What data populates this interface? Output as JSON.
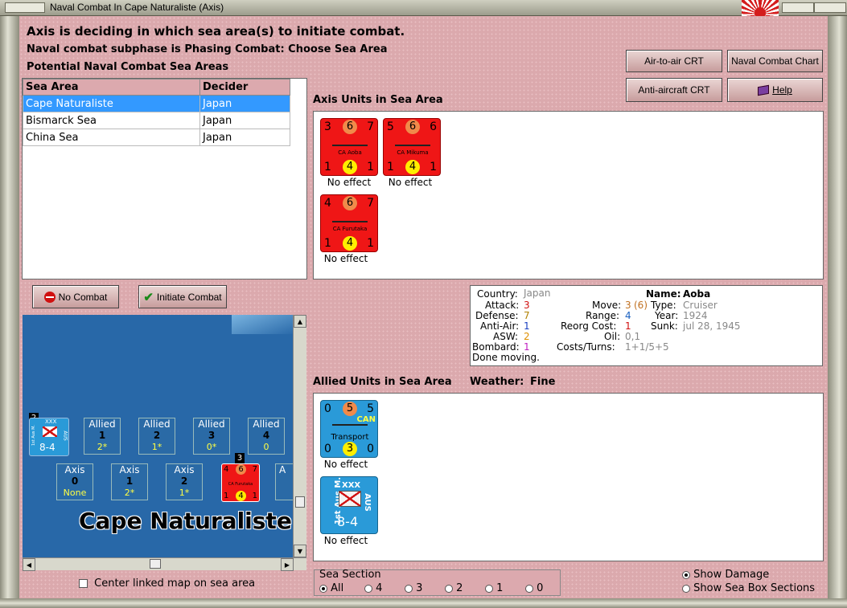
{
  "window": {
    "title": "Naval Combat In Cape Naturaliste (Axis)"
  },
  "header": {
    "line1": "Axis is deciding in which sea area(s) to initiate combat.",
    "line2": "Naval combat subphase is Phasing Combat: Choose Sea Area",
    "line3": "Potential Naval Combat Sea Areas"
  },
  "buttons": {
    "air_to_air": "Air-to-air CRT",
    "naval_chart": "Naval Combat Chart",
    "anti_aircraft": "Anti-aircraft CRT",
    "help": "Help",
    "no_combat": "No Combat",
    "initiate_combat": "Initiate Combat"
  },
  "sea_table": {
    "headers": [
      "Sea Area",
      "Decider"
    ],
    "rows": [
      {
        "area": "Cape Naturaliste",
        "decider": "Japan"
      },
      {
        "area": "Bismarck Sea",
        "decider": "Japan"
      },
      {
        "area": "China Sea",
        "decider": "Japan"
      }
    ]
  },
  "axis_units": {
    "title": "Axis Units in Sea Area",
    "units": [
      {
        "name": "CA Aoba",
        "tl": "3",
        "tc": "6",
        "tr": "7",
        "bl": "1",
        "bc": "4",
        "br": "1",
        "result": "No effect"
      },
      {
        "name": "CA Mikuma",
        "tl": "5",
        "tc": "6",
        "tr": "6",
        "bl": "1",
        "bc": "4",
        "br": "1",
        "result": "No effect"
      },
      {
        "name": "CA Furutaka",
        "tl": "4",
        "tc": "6",
        "tr": "7",
        "bl": "1",
        "bc": "4",
        "br": "1",
        "result": "No effect"
      }
    ]
  },
  "info": {
    "country_label": "Country:",
    "country": "Japan",
    "name_label": "Name:",
    "name": "Aoba",
    "attack_label": "Attack:",
    "attack": "3",
    "move_label": "Move:",
    "move": "3",
    "move_extra": "(6)",
    "type_label": "Type:",
    "type": "Cruiser",
    "defense_label": "Defense:",
    "defense": "7",
    "range_label": "Range:",
    "range": "4",
    "year_label": "Year:",
    "year": "1924",
    "antiair_label": "Anti-Air:",
    "antiair": "1",
    "reorg_label": "Reorg Cost:",
    "reorg": "1",
    "sunk_label": "Sunk:",
    "sunk": "jul 28, 1945",
    "asw_label": "ASW:",
    "asw": "2",
    "oil_label": "Oil:",
    "oil": "0,1",
    "bombard_label": "Bombard:",
    "bombard": "1",
    "costs_label": "Costs/Turns:",
    "costs": "1+1/5+5",
    "status": "Done moving."
  },
  "allied_units": {
    "title": "Allied Units in Sea Area",
    "weather_label": "Weather:",
    "weather": "Fine",
    "transport": {
      "tl": "0",
      "tc": "5",
      "tr": "5",
      "flag": "CAN",
      "name": "Transport",
      "bl": "0",
      "bc": "3",
      "br": "0",
      "result": "No effect"
    },
    "corps": {
      "side": "1st Aus M.",
      "size": "XXX",
      "nat": "AUS",
      "strength": "8-4",
      "result": "No effect"
    }
  },
  "map": {
    "name": "Cape Naturaliste",
    "allied_boxes": [
      {
        "side": "Allied",
        "num": "1",
        "val": "2*"
      },
      {
        "side": "Allied",
        "num": "2",
        "val": "1*"
      },
      {
        "side": "Allied",
        "num": "3",
        "val": "0*"
      },
      {
        "side": "Allied",
        "num": "4",
        "val": "0"
      }
    ],
    "axis_boxes": [
      {
        "side": "Axis",
        "num": "0",
        "val": "None"
      },
      {
        "side": "Axis",
        "num": "1",
        "val": "2*"
      },
      {
        "side": "Axis",
        "num": "2",
        "val": "1*"
      }
    ],
    "stack_count_allied": "2",
    "stack_count_axis": "3",
    "mini_unit_name": "CA Furutaka",
    "mini_corps": {
      "size": "XXX",
      "side": "1st Aus M.",
      "nat": "AUS",
      "strength": "8-4"
    },
    "mini_counter": {
      "tl": "4",
      "tc": "6",
      "tr": "7",
      "bl": "1",
      "bc": "4",
      "br": "1"
    },
    "partial_box": "A"
  },
  "center_link": {
    "label": "Center linked map on sea area",
    "checked": false
  },
  "sea_section": {
    "title": "Sea Section",
    "options": [
      "All",
      "4",
      "3",
      "2",
      "1",
      "0"
    ],
    "selected": "All"
  },
  "display_options": {
    "show_damage": "Show Damage",
    "show_sections": "Show Sea Box Sections",
    "selected": "Show Damage"
  },
  "colors": {
    "axis_red": "#ef1616",
    "allied_blue": "#2a9ad8",
    "selection": "#3399ff",
    "background": "#dba9ad"
  }
}
